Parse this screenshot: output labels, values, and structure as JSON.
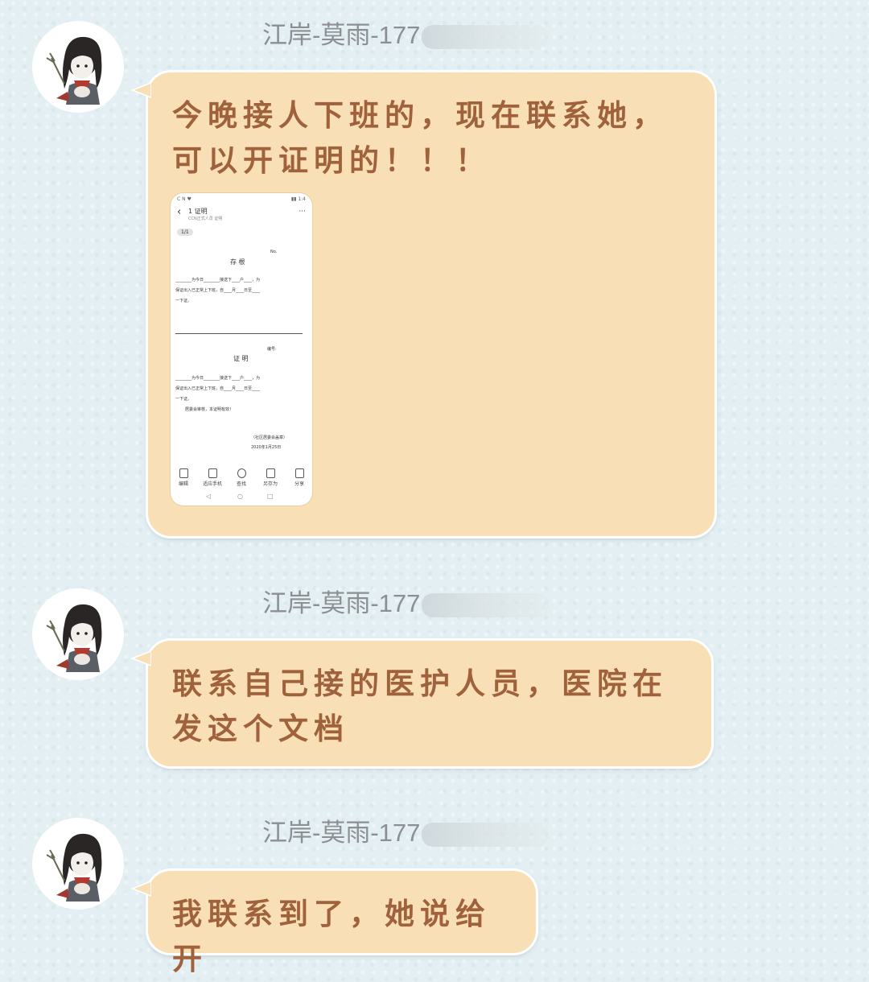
{
  "messages": [
    {
      "sender_visible": "江岸-莫雨-177",
      "text": "今晚接人下班的，现在联系她，可以开证明的！！！",
      "attachment": {
        "status_left": "C N ♥",
        "status_right": "▮▮ 1:4",
        "back_icon": "chevron-left-icon",
        "title": "1 证明",
        "subtitle": "CCN正式人员 证明",
        "more_icon": "more-icon",
        "page_badge": "1/1",
        "doc1_heading": "存 根",
        "doc1_no": "No.",
        "doc1_line1": "________为今日________接送下____户____，为",
        "doc1_line2": "保证出入已正常上下班，自____月____日至____",
        "doc1_line3": "一下证。",
        "doc2_heading": "证 明",
        "doc2_no": "编号:",
        "doc2_line1": "________为今日________接送下____户____，为",
        "doc2_line2": "保证出入已正常上下班，自____月____日至____",
        "doc2_line3": "一下证。",
        "doc2_line4": "居委会审核，本证明有效！",
        "sign_org": "（社区居委会盖章）",
        "sign_date": "2020年1月25日",
        "toolbar": [
          "编辑",
          "适应手机",
          "查找",
          "另存为",
          "分享"
        ],
        "nav": [
          "◁",
          "○",
          "□"
        ]
      }
    },
    {
      "sender_visible": "江岸-莫雨-177",
      "text": "联系自己接的医护人员，医院在发这个文档"
    },
    {
      "sender_visible": "江岸-莫雨-177",
      "text": "我联系到了，她说给开"
    }
  ],
  "colors": {
    "background": "#e3eff2",
    "bubble": "#f8dfb5",
    "bubble_text": "#a0623c",
    "sender_name": "#8c8f93"
  },
  "icons": {
    "avatar": "cartoon-character-avatar"
  }
}
